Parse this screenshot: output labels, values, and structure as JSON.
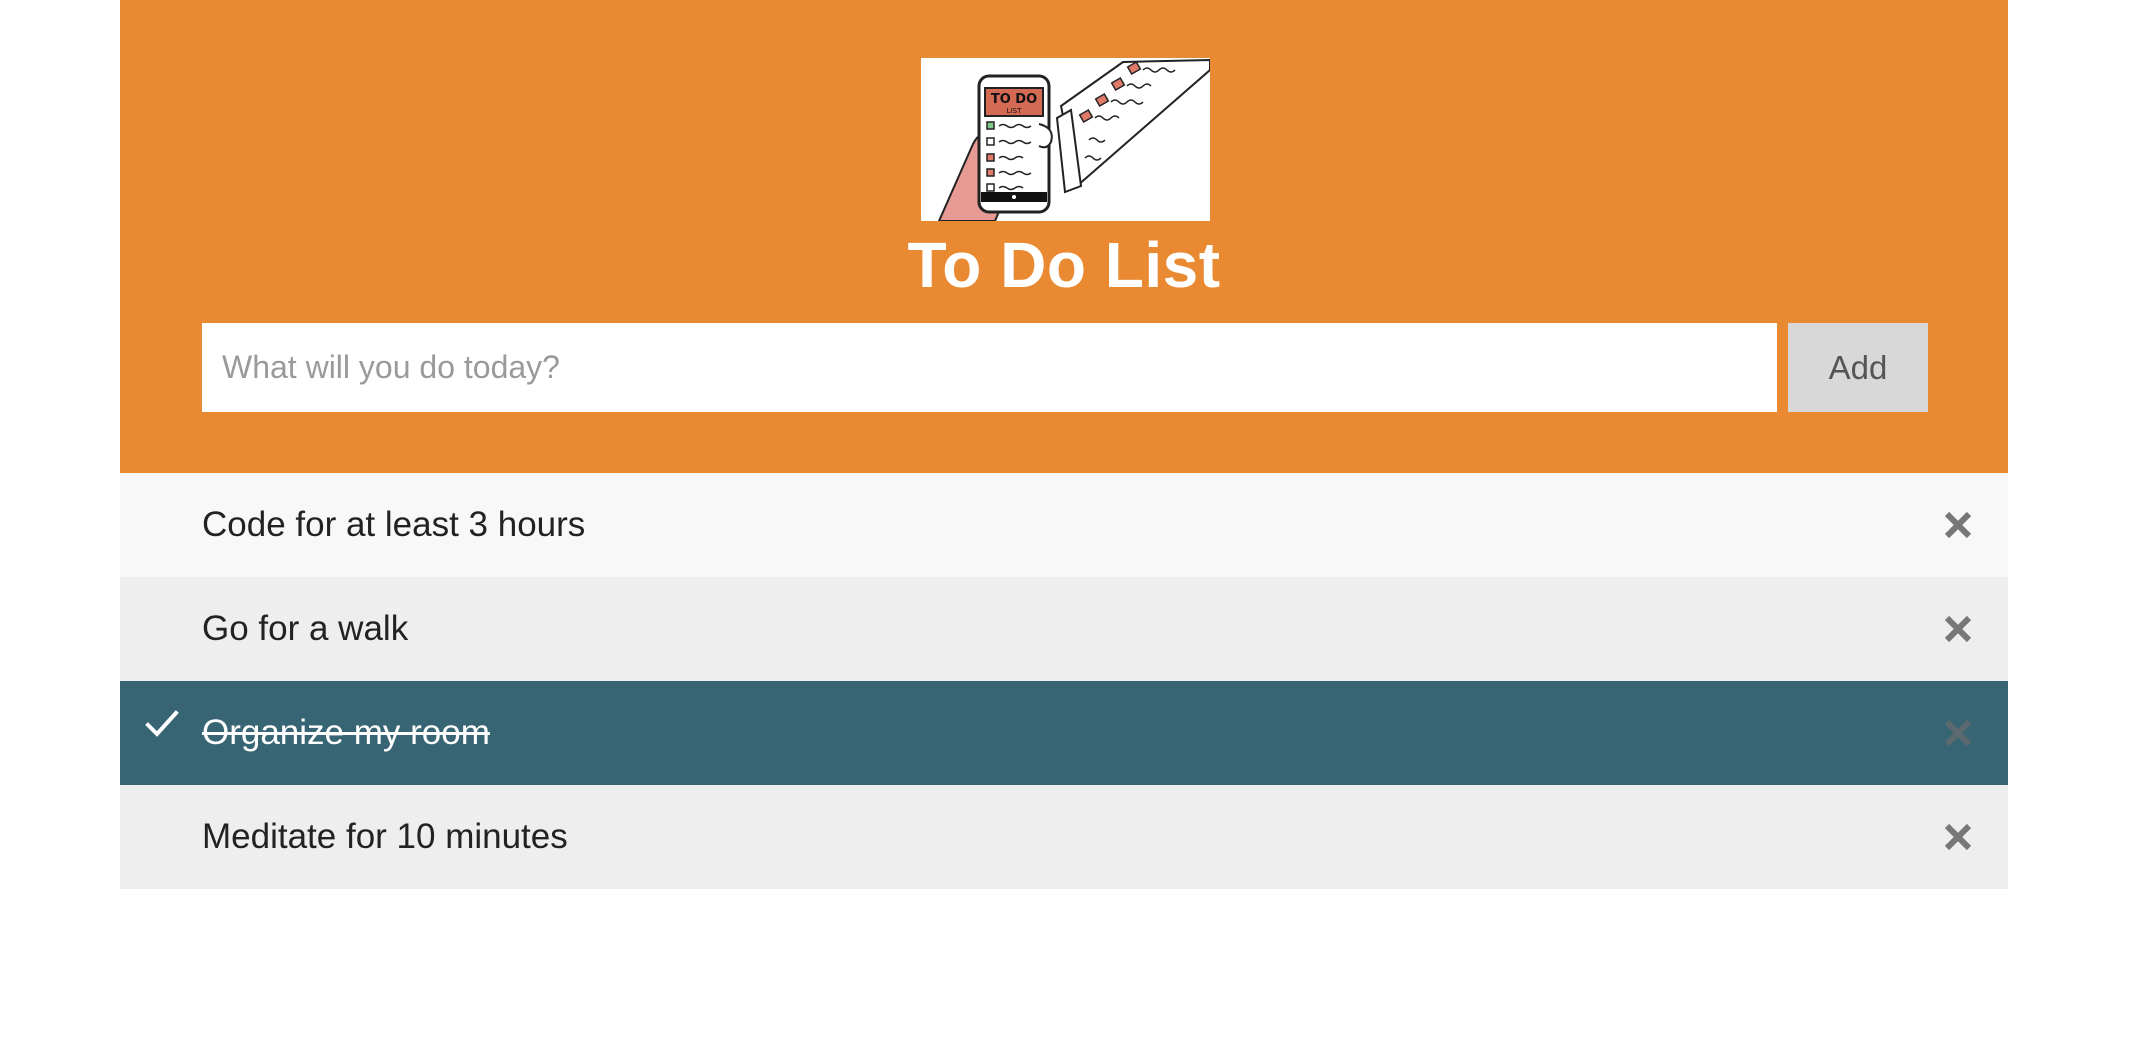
{
  "header": {
    "title": "To Do List",
    "logo_icon": "todo-list-phone-illustration",
    "logo_lettering": "TO DO LIST",
    "background_color": "#e98a32"
  },
  "form": {
    "placeholder": "What will you do today?",
    "value": "",
    "add_label": "Add"
  },
  "tasks": [
    {
      "text": "Code for at least 3 hours",
      "checked": false
    },
    {
      "text": "Go for a walk",
      "checked": false
    },
    {
      "text": "Organize my room",
      "checked": true
    },
    {
      "text": "Meditate for 10 minutes",
      "checked": false
    }
  ],
  "icons": {
    "check": "check-icon",
    "close": "close-icon"
  },
  "colors": {
    "accent": "#e98a32",
    "checked_row": "#386573",
    "close_icon": "#777777"
  }
}
